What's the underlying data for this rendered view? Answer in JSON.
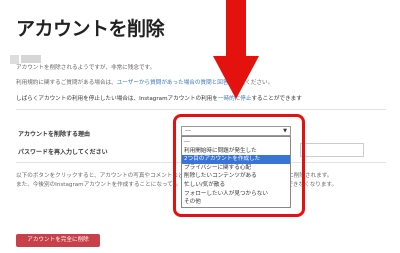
{
  "header": {
    "title": "アカウントを削除"
  },
  "intro": {
    "line1": "アカウントを削除されるようですが、非常に残念です。",
    "line2_prefix": "利用規約に関するご質問がある場合は、",
    "line2_link": "ユーザーから質問があった場合の質問と回答",
    "line2_suffix": "をご覧ください。",
    "line3_prefix": "しばらくアカウントの利用を停止したい場合は、Instagramアカウントの利用を",
    "line3_link": "一時的に停止",
    "line3_suffix": "することができます"
  },
  "form": {
    "reason_label": "アカウントを削除する理由",
    "password_label": "パスワードを再入力してください",
    "reason_select": {
      "value": "---"
    },
    "reason_options": [
      "---",
      "利用開始時に問題が発生した",
      "2つ目のアカウントを作成した",
      "プライバシーに関する心配",
      "削除したいコンテンツがある",
      "忙しい/気が散る",
      "フォローしたい人が見つからない",
      "その他"
    ],
    "selected_index": 2
  },
  "warning": {
    "line1_prefix": "以下のボタンをクリックすると、アカウントの写真やコメントなどすべての",
    "line1_suffix": "が完全に削除されます。",
    "line2_prefix": "また、今後別のInstagramアカウントを作成することになっても",
    "line2_suffix": "使用することはできなくなります。"
  },
  "actions": {
    "delete_label": "アカウントを完全に削除"
  },
  "colors": {
    "annotation": "#e4120f",
    "delete_button": "#c9404a",
    "selection": "#3875d7",
    "link": "#3b73b9"
  }
}
